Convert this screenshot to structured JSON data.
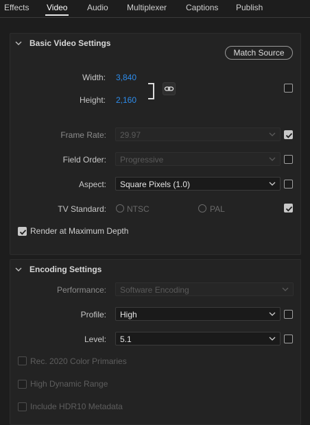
{
  "tabs": [
    {
      "label": "Effects"
    },
    {
      "label": "Video"
    },
    {
      "label": "Audio"
    },
    {
      "label": "Multiplexer"
    },
    {
      "label": "Captions"
    },
    {
      "label": "Publish"
    }
  ],
  "active_tab": "Video",
  "basic_video": {
    "title": "Basic Video Settings",
    "match_source_label": "Match Source",
    "width_label": "Width:",
    "width_value": "3,840",
    "height_label": "Height:",
    "height_value": "2,160",
    "frame_rate_label": "Frame Rate:",
    "frame_rate_value": "29.97",
    "field_order_label": "Field Order:",
    "field_order_value": "Progressive",
    "aspect_label": "Aspect:",
    "aspect_value": "Square Pixels (1.0)",
    "tv_standard_label": "TV Standard:",
    "ntsc_label": "NTSC",
    "pal_label": "PAL",
    "render_max_depth_label": "Render at Maximum Depth",
    "checks": {
      "dimensions": false,
      "frame_rate": true,
      "field_order": false,
      "aspect": false,
      "tv_standard": true,
      "render_max_depth": true
    }
  },
  "encoding": {
    "title": "Encoding Settings",
    "performance_label": "Performance:",
    "performance_value": "Software Encoding",
    "profile_label": "Profile:",
    "profile_value": "High",
    "level_label": "Level:",
    "level_value": "5.1",
    "rec2020_label": "Rec. 2020 Color Primaries",
    "hdr_label": "High Dynamic Range",
    "hdr10_label": "Include HDR10 Metadata",
    "checks": {
      "profile": false,
      "level": false,
      "rec2020": false,
      "hdr": false,
      "hdr10": false
    }
  },
  "colors": {
    "accent_blue": "#2d8ceb",
    "background": "#1d1d1d",
    "panel": "#232323"
  }
}
